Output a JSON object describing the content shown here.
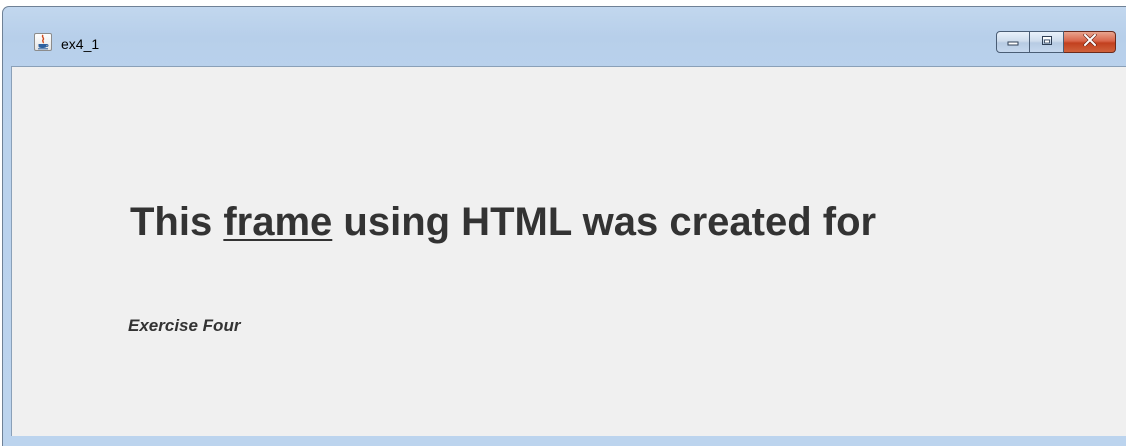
{
  "window": {
    "title": "ex4_1",
    "icon": "java-cup-icon",
    "controls": {
      "minimize_icon": "minimize-icon",
      "maximize_icon": "maximize-icon",
      "close_icon": "close-icon"
    }
  },
  "content": {
    "headline_before": "This ",
    "headline_link": "frame",
    "headline_after": " using HTML was created for",
    "subtitle": "Exercise Four"
  },
  "colors": {
    "text": "#333333",
    "content_background": "#f0f0f0",
    "titlebar": "#b9d1ec",
    "close_button": "#c7472a"
  }
}
